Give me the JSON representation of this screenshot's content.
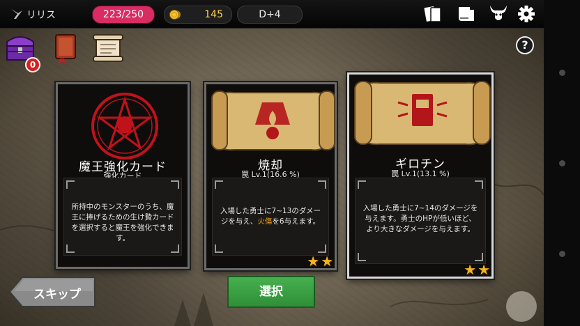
{
  "header": {
    "player_name": "リリス",
    "hp": "223/250",
    "gold": "145",
    "day": "D+4",
    "icons": [
      "cards-icon",
      "book-icon",
      "demon-horns-icon",
      "gear-icon"
    ]
  },
  "dock": {
    "chest_badge": "0",
    "icons": [
      "treasure-chest-icon",
      "spellbook-icon",
      "scroll-icon"
    ],
    "help_label": "?"
  },
  "cards": [
    {
      "title": "魔王強化カード",
      "subtitle": "強化カード",
      "description": "所持中のモンスターのうち、魔王に捧げるための生け贄カードを選択すると魔王を強化できます。",
      "stars": 0
    },
    {
      "title": "焼却",
      "subtitle": "罠 Lv.1(16.6 %)",
      "description_parts": [
        "入場した勇士に7~13のダメージを与え、",
        "火傷",
        "を6与えます。"
      ],
      "stars": 2
    },
    {
      "title": "ギロチン",
      "subtitle": "罠 Lv.1(13.1 %)",
      "description": "入場した勇士に7~14のダメージを与えます。勇士のHPが低いほど、より大きなダメージを与えます。",
      "stars": 2
    }
  ],
  "buttons": {
    "skip": "スキップ",
    "select": "選択"
  },
  "colors": {
    "hp_pill": "#d82c63",
    "gold_text": "#ffd24a",
    "select_button": "#3a9f42",
    "emblem_red": "#c0121b",
    "star": "#f2b31c"
  }
}
